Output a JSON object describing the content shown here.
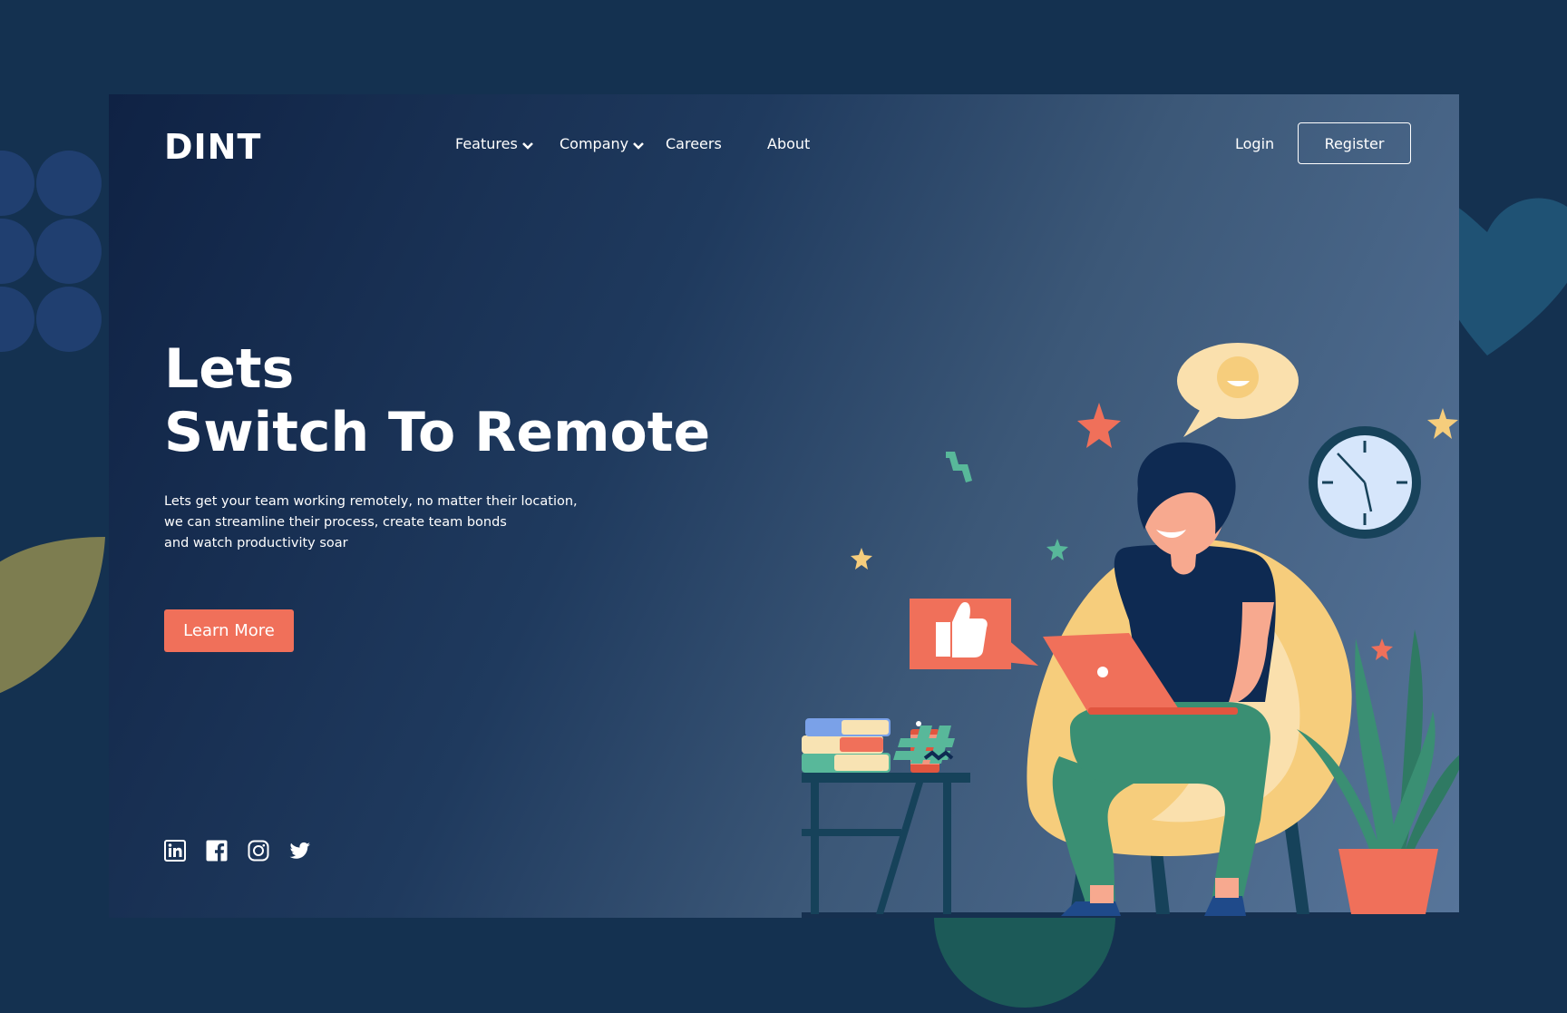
{
  "brand": {
    "logo": "DINT"
  },
  "nav": {
    "features": "Features",
    "company": "Company",
    "careers": "Careers",
    "about": "About"
  },
  "auth": {
    "login": "Login",
    "register": "Register"
  },
  "hero": {
    "title_line1": "Lets",
    "title_line2": "Switch To Remote",
    "desc_line1": "Lets get your team working remotely, no matter their location,",
    "desc_line2": "we can streamline their process, create team bonds",
    "desc_line3": "and watch productivity soar",
    "cta": "Learn More"
  },
  "socials": [
    "linkedin-icon",
    "facebook-icon",
    "instagram-icon",
    "twitter-icon"
  ],
  "colors": {
    "background": "#143150",
    "card_start": "#0f2244",
    "card_end": "#57759a",
    "accent": "#f0705a",
    "chair": "#f6cd7c",
    "plant": "#3a8f73",
    "shirt": "#0e2a52"
  }
}
